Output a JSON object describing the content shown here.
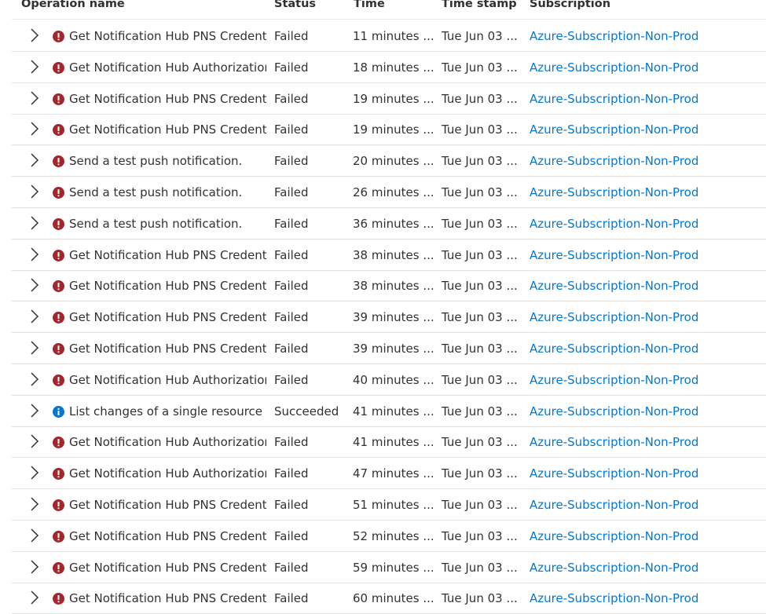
{
  "columns": {
    "operation": "Operation name",
    "status": "Status",
    "time": "Time",
    "timestamp": "Time stamp",
    "subscription": "Subscription"
  },
  "colors": {
    "failed_icon": "#a4262c",
    "info_icon": "#0078d4",
    "link": "#0078d4"
  },
  "rows": [
    {
      "op": "Get Notification Hub PNS Credenti",
      "status": "Failed",
      "time": "11 minutes ...",
      "timestamp": "Tue Jun 03 ...",
      "subscription": "Azure-Subscription-Non-Prod",
      "icon": "error-icon"
    },
    {
      "op": "Get Notification Hub Authorization",
      "status": "Failed",
      "time": "18 minutes ...",
      "timestamp": "Tue Jun 03 ...",
      "subscription": "Azure-Subscription-Non-Prod",
      "icon": "error-icon"
    },
    {
      "op": "Get Notification Hub PNS Credenti",
      "status": "Failed",
      "time": "19 minutes ...",
      "timestamp": "Tue Jun 03 ...",
      "subscription": "Azure-Subscription-Non-Prod",
      "icon": "error-icon"
    },
    {
      "op": "Get Notification Hub PNS Credenti",
      "status": "Failed",
      "time": "19 minutes ...",
      "timestamp": "Tue Jun 03 ...",
      "subscription": "Azure-Subscription-Non-Prod",
      "icon": "error-icon"
    },
    {
      "op": "Send a test push notification.",
      "status": "Failed",
      "time": "20 minutes ...",
      "timestamp": "Tue Jun 03 ...",
      "subscription": "Azure-Subscription-Non-Prod",
      "icon": "error-icon"
    },
    {
      "op": "Send a test push notification.",
      "status": "Failed",
      "time": "26 minutes ...",
      "timestamp": "Tue Jun 03 ...",
      "subscription": "Azure-Subscription-Non-Prod",
      "icon": "error-icon"
    },
    {
      "op": "Send a test push notification.",
      "status": "Failed",
      "time": "36 minutes ...",
      "timestamp": "Tue Jun 03 ...",
      "subscription": "Azure-Subscription-Non-Prod",
      "icon": "error-icon"
    },
    {
      "op": "Get Notification Hub PNS Credenti",
      "status": "Failed",
      "time": "38 minutes ...",
      "timestamp": "Tue Jun 03 ...",
      "subscription": "Azure-Subscription-Non-Prod",
      "icon": "error-icon"
    },
    {
      "op": "Get Notification Hub PNS Credenti",
      "status": "Failed",
      "time": "38 minutes ...",
      "timestamp": "Tue Jun 03 ...",
      "subscription": "Azure-Subscription-Non-Prod",
      "icon": "error-icon"
    },
    {
      "op": "Get Notification Hub PNS Credenti",
      "status": "Failed",
      "time": "39 minutes ...",
      "timestamp": "Tue Jun 03 ...",
      "subscription": "Azure-Subscription-Non-Prod",
      "icon": "error-icon"
    },
    {
      "op": "Get Notification Hub PNS Credenti",
      "status": "Failed",
      "time": "39 minutes ...",
      "timestamp": "Tue Jun 03 ...",
      "subscription": "Azure-Subscription-Non-Prod",
      "icon": "error-icon"
    },
    {
      "op": "Get Notification Hub Authorization",
      "status": "Failed",
      "time": "40 minutes ...",
      "timestamp": "Tue Jun 03 ...",
      "subscription": "Azure-Subscription-Non-Prod",
      "icon": "error-icon"
    },
    {
      "op": "List changes of a single resource",
      "status": "Succeeded",
      "time": "41 minutes ...",
      "timestamp": "Tue Jun 03 ...",
      "subscription": "Azure-Subscription-Non-Prod",
      "icon": "info-icon"
    },
    {
      "op": "Get Notification Hub Authorization",
      "status": "Failed",
      "time": "41 minutes ...",
      "timestamp": "Tue Jun 03 ...",
      "subscription": "Azure-Subscription-Non-Prod",
      "icon": "error-icon"
    },
    {
      "op": "Get Notification Hub Authorization",
      "status": "Failed",
      "time": "47 minutes ...",
      "timestamp": "Tue Jun 03 ...",
      "subscription": "Azure-Subscription-Non-Prod",
      "icon": "error-icon"
    },
    {
      "op": "Get Notification Hub PNS Credenti",
      "status": "Failed",
      "time": "51 minutes ...",
      "timestamp": "Tue Jun 03 ...",
      "subscription": "Azure-Subscription-Non-Prod",
      "icon": "error-icon"
    },
    {
      "op": "Get Notification Hub PNS Credenti",
      "status": "Failed",
      "time": "52 minutes ...",
      "timestamp": "Tue Jun 03 ...",
      "subscription": "Azure-Subscription-Non-Prod",
      "icon": "error-icon"
    },
    {
      "op": "Get Notification Hub PNS Credenti",
      "status": "Failed",
      "time": "59 minutes ...",
      "timestamp": "Tue Jun 03 ...",
      "subscription": "Azure-Subscription-Non-Prod",
      "icon": "error-icon"
    },
    {
      "op": "Get Notification Hub PNS Credenti",
      "status": "Failed",
      "time": "60 minutes ...",
      "timestamp": "Tue Jun 03 ...",
      "subscription": "Azure-Subscription-Non-Prod",
      "icon": "error-icon"
    }
  ]
}
